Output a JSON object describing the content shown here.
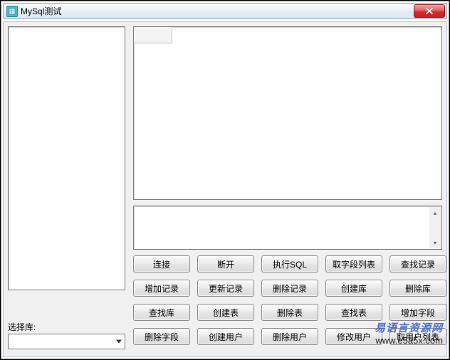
{
  "window": {
    "title": "MySql测试"
  },
  "labels": {
    "select_db": "选择库:"
  },
  "combo": {
    "selected": ""
  },
  "log": {
    "value": ""
  },
  "buttons": {
    "r0": [
      "连接",
      "断开",
      "执行SQL",
      "取字段列表",
      "查找记录"
    ],
    "r1": [
      "增加记录",
      "更新记录",
      "删除记录",
      "创建库",
      "删除库"
    ],
    "r2": [
      "查找库",
      "创建表",
      "删除表",
      "查找表",
      "增加字段"
    ],
    "r3": [
      "删除字段",
      "创建用户",
      "删除用户",
      "修改用户",
      "取用户列表"
    ]
  },
  "watermark": {
    "site_name": "易语言资源网",
    "url": "www.e5a5x.com"
  }
}
